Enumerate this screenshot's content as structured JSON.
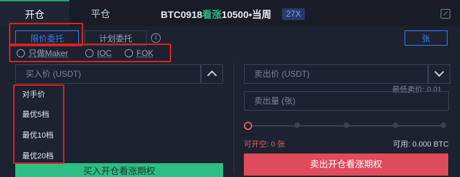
{
  "tabs": {
    "open": "开仓",
    "close": "平仓"
  },
  "contract": {
    "prefix": "BTC0918",
    "direction": "看涨",
    "strike": "10500",
    "suffix": "•当周",
    "leverage": "27X"
  },
  "order_types": {
    "limit": "限价委托",
    "plan": "计划委托",
    "info_glyph": "i"
  },
  "unit_button": "张",
  "radios": [
    "只做Maker",
    "IOC",
    "FOK"
  ],
  "buy": {
    "price_placeholder": "买入价 (USDT)",
    "button_label": "买入开仓看涨期权"
  },
  "sell": {
    "price_placeholder": "卖出价 (USDT)",
    "qty_placeholder": "卖出量 (张)",
    "min_price": "最低卖价: 0.01",
    "available_short": "可开空: 0 张",
    "available": "可用: 0.000 BTC",
    "button_label": "卖出开仓看涨期权"
  },
  "price_options": [
    "对手价",
    "最优5档",
    "最优10档",
    "最优20档"
  ],
  "colors": {
    "accent": "#3d7bf7",
    "buy_green": "#2ebd85",
    "sell_red": "#e04b5a",
    "highlight_box": "#e02020"
  },
  "icons": {
    "expand": "expand-icon",
    "info": "info-icon",
    "chevron_up": "chevron-up-icon",
    "chevron_down": "chevron-down-icon"
  }
}
